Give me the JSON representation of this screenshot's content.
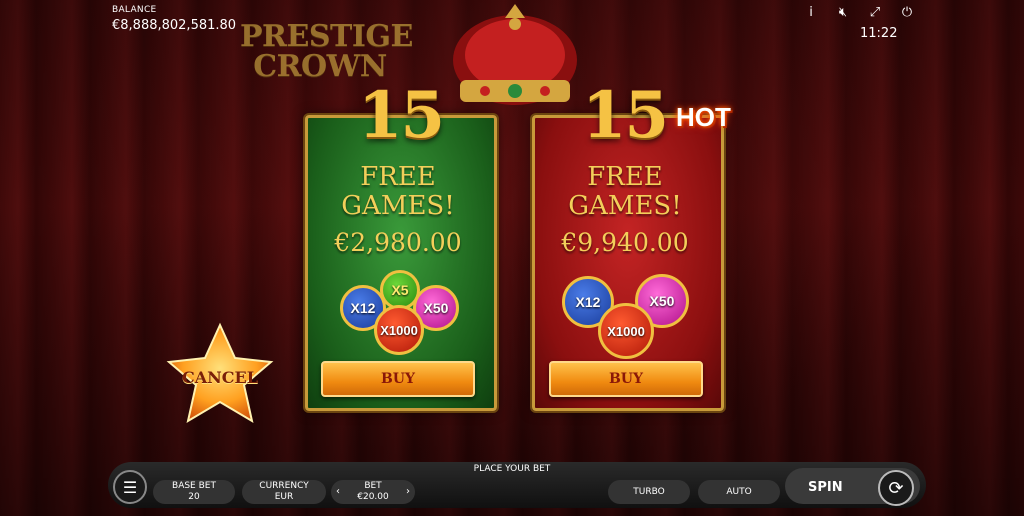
{
  "header": {
    "balance_label": "BALANCE",
    "balance_value": "€8,888,802,581.80",
    "clock": "11:22",
    "logo_line1": "PRESTIGE",
    "logo_line2": "CROWN"
  },
  "offers": [
    {
      "count": "15",
      "title_line1": "FREE",
      "title_line2": "GAMES!",
      "price": "€2,980.00",
      "coins": [
        "X12",
        "X5",
        "X50",
        "X1000"
      ],
      "buy_label": "BUY",
      "color": "#1a5e1a"
    },
    {
      "count": "15",
      "badge": "HOT",
      "title_line1": "FREE",
      "title_line2": "GAMES!",
      "price": "€9,940.00",
      "coins": [
        "X12",
        "X50",
        "X1000"
      ],
      "buy_label": "BUY",
      "color": "#8a0f0f"
    }
  ],
  "cancel_label": "CANCEL",
  "bottom": {
    "place_bet": "PLACE YOUR BET",
    "base_bet_label": "BASE BET",
    "base_bet_value": "20",
    "currency_label": "CURRENCY",
    "currency_value": "EUR",
    "bet_label": "BET",
    "bet_value": "€20.00",
    "turbo_label": "TURBO",
    "auto_label": "AUTO",
    "spin_label": "SPIN"
  },
  "icons": {
    "info": "info-icon",
    "mute": "mute-icon",
    "fullscreen": "fullscreen-icon",
    "power": "power-icon",
    "menu": "menu-icon",
    "spin": "spin-icon"
  }
}
